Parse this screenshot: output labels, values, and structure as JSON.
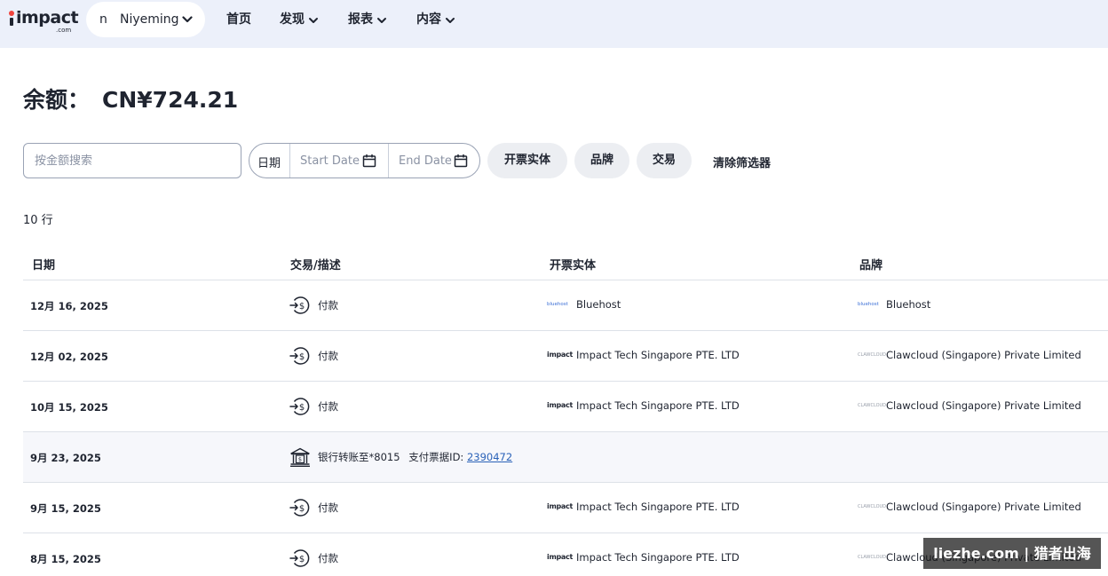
{
  "nav": {
    "logo_text": "impact",
    "logo_suffix": ".com",
    "account_initial": "n",
    "account_name": "Niyeming",
    "items": [
      {
        "label": "首页"
      },
      {
        "label": "发现"
      },
      {
        "label": "报表"
      },
      {
        "label": "内容"
      }
    ]
  },
  "balance": {
    "label": "余额：",
    "amount": "CN¥724.21"
  },
  "filters": {
    "search_placeholder": "按金额搜索",
    "date_label": "日期",
    "start_date_placeholder": "Start Date",
    "end_date_placeholder": "End Date",
    "chips": [
      {
        "label": "开票实体"
      },
      {
        "label": "品牌"
      },
      {
        "label": "交易"
      }
    ],
    "clear_label": "清除筛选器"
  },
  "row_count": "10 行",
  "table": {
    "headers": {
      "date": "日期",
      "transaction": "交易/描述",
      "entity": "开票实体",
      "brand": "品牌"
    },
    "rows": [
      {
        "date": "12月 16, 2025",
        "type": "payment",
        "description": "付款",
        "entity_logo": "bluehost",
        "entity": "Bluehost",
        "brand_logo": "bluehost",
        "brand": "Bluehost"
      },
      {
        "date": "12月 02, 2025",
        "type": "payment",
        "description": "付款",
        "entity_logo": "impact",
        "entity": "Impact Tech Singapore PTE. LTD",
        "brand_logo": "clawcloud",
        "brand": "Clawcloud (Singapore) Private Limited"
      },
      {
        "date": "10月 15, 2025",
        "type": "payment",
        "description": "付款",
        "entity_logo": "impact",
        "entity": "Impact Tech Singapore PTE. LTD",
        "brand_logo": "clawcloud",
        "brand": "Clawcloud (Singapore) Private Limited"
      },
      {
        "date": "9月 23, 2025",
        "type": "bank",
        "description": "银行转账至*8015",
        "ticket_label": "支付票据ID:",
        "ticket_id": "2390472",
        "entity_logo": "",
        "entity": "",
        "brand_logo": "",
        "brand": ""
      },
      {
        "date": "9月 15, 2025",
        "type": "payment",
        "description": "付款",
        "entity_logo": "impact",
        "entity": "Impact Tech Singapore PTE. LTD",
        "brand_logo": "clawcloud",
        "brand": "Clawcloud (Singapore) Private Limited"
      },
      {
        "date": "8月 15, 2025",
        "type": "payment",
        "description": "付款",
        "entity_logo": "impact",
        "entity": "Impact Tech Singapore PTE. LTD",
        "brand_logo": "clawcloud",
        "brand": "Clawcloud (Singapore) Private Limited"
      }
    ]
  },
  "mini_logos": {
    "impact": "impact",
    "bluehost": "bluehost",
    "clawcloud": "CLAWCLOUD"
  },
  "watermark": "liezhe.com | 猎者出海"
}
